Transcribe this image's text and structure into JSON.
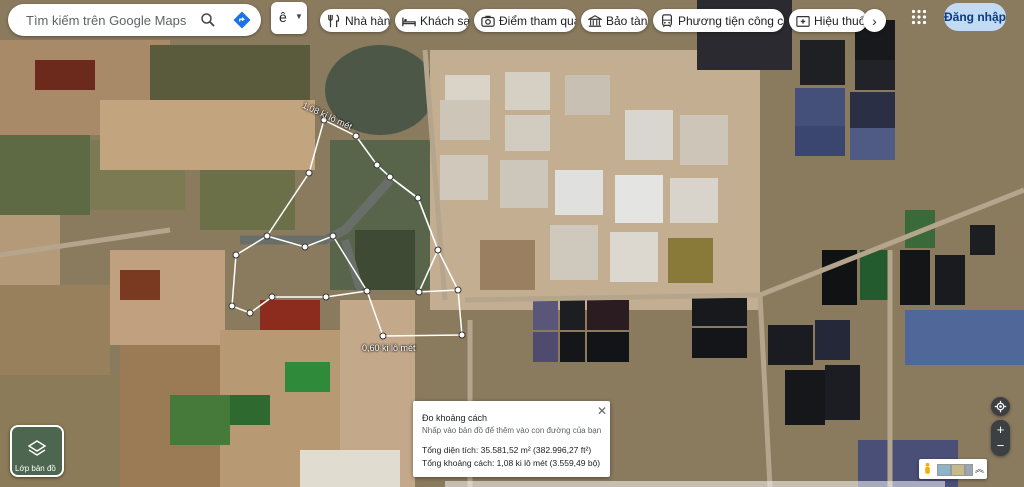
{
  "search": {
    "placeholder": "Tìm kiếm trên Google Maps"
  },
  "language": {
    "value": "ê"
  },
  "chips": [
    {
      "label": "Nhà hàng",
      "icon": "restaurant-icon"
    },
    {
      "label": "Khách sạn",
      "icon": "hotel-icon"
    },
    {
      "label": "Điểm tham quan",
      "icon": "camera-icon"
    },
    {
      "label": "Bảo tàng",
      "icon": "museum-icon"
    },
    {
      "label": "Phương tiện công cộng",
      "icon": "transit-icon"
    },
    {
      "label": "Hiệu thuốc",
      "icon": "pharmacy-icon"
    }
  ],
  "more_chip": {
    "glyph": "›"
  },
  "signin": {
    "label": "Đăng nhập"
  },
  "layers": {
    "label": "Lớp bản đồ"
  },
  "distance_labels": {
    "top": "1,08 ki lô mét",
    "bottom": "0,60 ki lô mét"
  },
  "measure": {
    "title": "Đo khoảng cách",
    "hint": "Nhấp vào bản đồ để thêm vào con đường của bạn",
    "area": "Tổng diện tích: 35.581,52 m² (382.996,27 ft²)",
    "distance": "Tổng khoảng cách: 1,08 ki lô mét (3.559,49 bộ)",
    "close": "✕"
  },
  "controls": {
    "zoom_in": "+",
    "zoom_out": "−",
    "expand": "︽"
  },
  "colors": {
    "accent": "#1a73e8",
    "signin_bg": "#c2dbf5",
    "route_line": "#ffffff"
  }
}
